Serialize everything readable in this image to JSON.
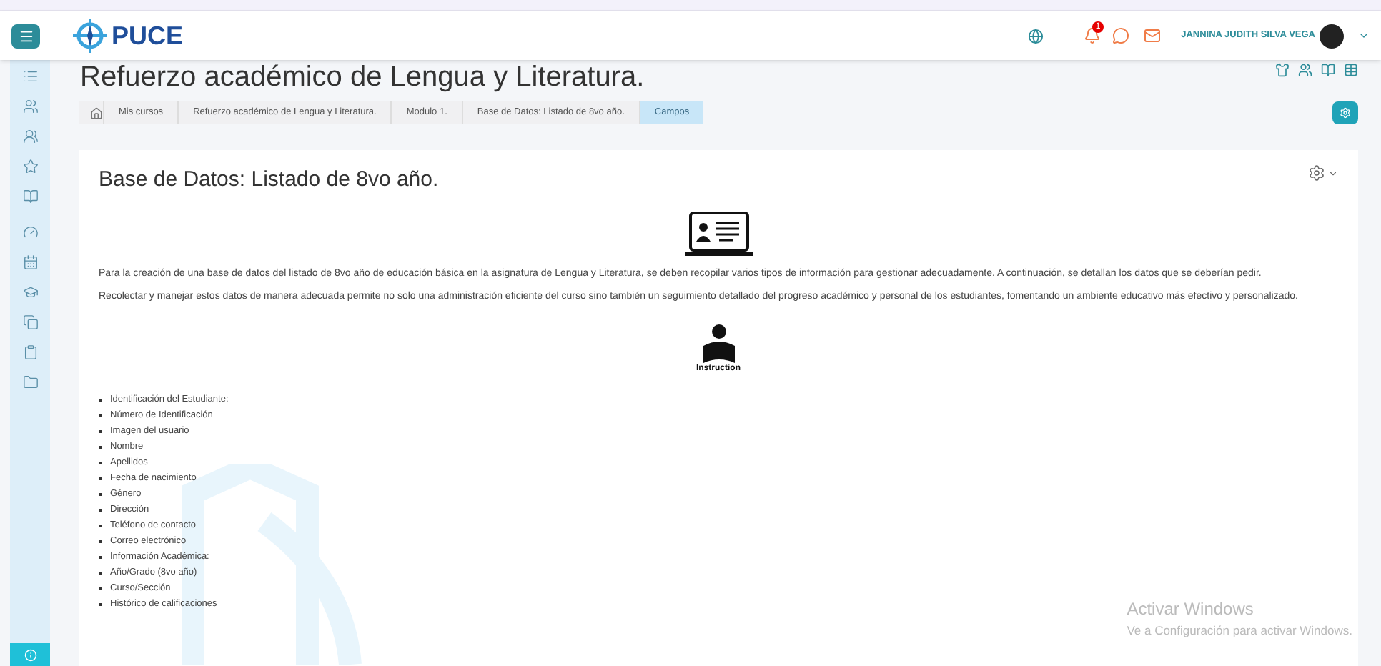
{
  "header": {
    "brand": "PUCE",
    "notification_count": "1",
    "user_name": "JANNINA JUDITH SILVA VEGA"
  },
  "page_title": "Refuerzo académico de Lengua y Literatura.",
  "breadcrumb": [
    {
      "label": "Mis cursos",
      "selected": false
    },
    {
      "label": "Refuerzo académico de Lengua y Literatura.",
      "selected": false
    },
    {
      "label": "Modulo 1.",
      "selected": false
    },
    {
      "label": "Base de Datos: Listado de 8vo año.",
      "selected": false
    },
    {
      "label": "Campos",
      "selected": true
    }
  ],
  "content": {
    "title": "Base de Datos: Listado de 8vo año.",
    "paragraphs": [
      "Para la creación de una base de datos del listado de 8vo año de educación básica en la asignatura de Lengua y Literatura, se deben recopilar varios tipos de información para gestionar adecuadamente. A continuación, se detallan los datos que se deberían pedir.",
      "Recolectar y manejar estos datos de manera adecuada permite no solo una administración eficiente del curso sino también un seguimiento detallado del progreso académico y personal de los estudiantes, fomentando un ambiente educativo más efectivo y personalizado."
    ],
    "image_caption": "Instruction",
    "fields": [
      "Identificación del Estudiante:",
      "Número de Identificación",
      "Imagen del usuario",
      "Nombre",
      "Apellidos",
      "Fecha de nacimiento",
      "Género",
      "Dirección",
      "Teléfono de contacto",
      "Correo electrónico",
      "Información Académica:",
      "Año/Grado (8vo año)",
      "Curso/Sección",
      "Histórico de calificaciones"
    ]
  },
  "windows_notice": {
    "title": "Activar Windows",
    "text": "Ve a Configuración para activar Windows."
  }
}
